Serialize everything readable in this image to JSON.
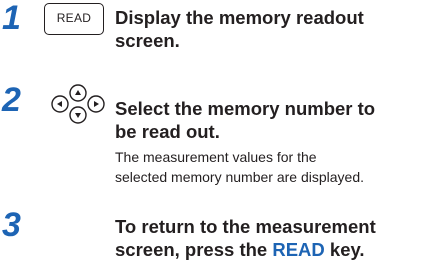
{
  "steps": [
    {
      "number": "1",
      "key_label": "READ",
      "title_lines": [
        "Display the memory readout",
        "screen."
      ]
    },
    {
      "number": "2",
      "key_icon": "up-down-left-right-arrow-keys-icon",
      "title_lines": [
        "Select the memory number to",
        "be read out."
      ],
      "description_lines": [
        "The measurement values for the",
        "selected memory number are displayed."
      ]
    },
    {
      "number": "3",
      "title_lines": [
        "To return to the measurement"
      ],
      "title_line2_prefix": "screen, press the ",
      "title_line2_key": "READ",
      "title_line2_suffix": " key."
    }
  ],
  "colors": {
    "accent": "#1d64b4",
    "text": "#231f20"
  }
}
